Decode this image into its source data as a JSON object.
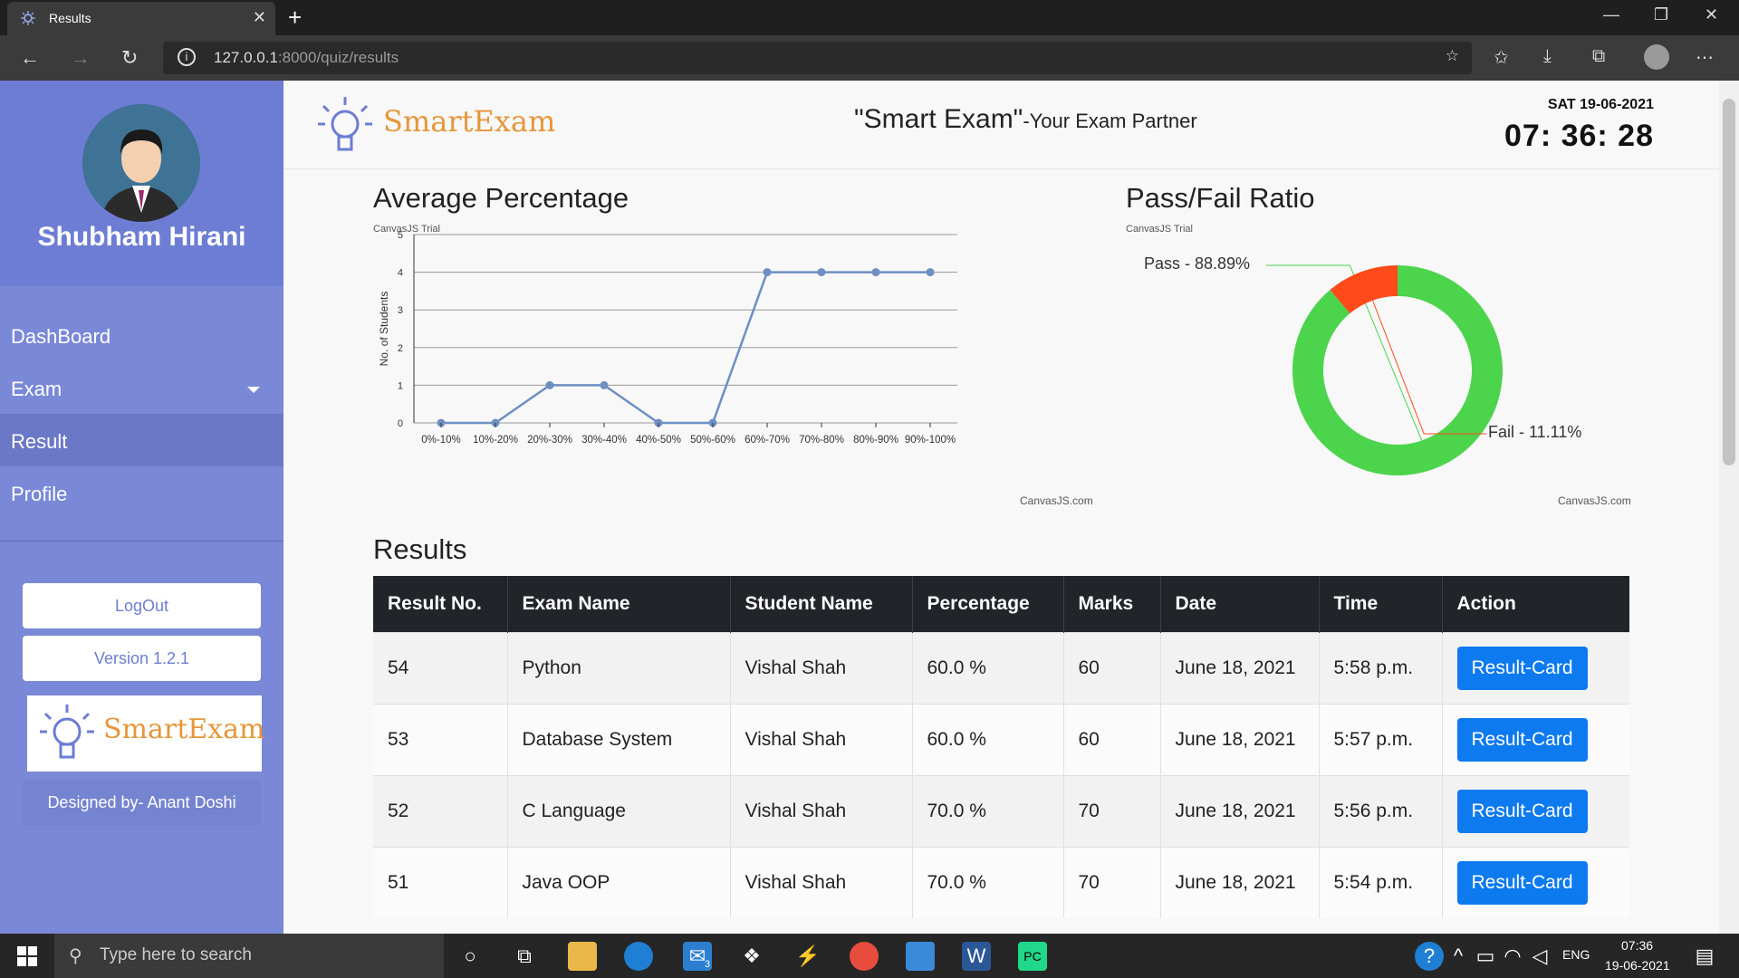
{
  "browser": {
    "tab_title": "Results",
    "url_host": "127.0.0.1",
    "url_rest": ":8000/quiz/results"
  },
  "sidebar": {
    "user_name": "Shubham Hirani",
    "menu": [
      "DashBoard",
      "Exam",
      "Result",
      "Profile"
    ],
    "logout": "LogOut",
    "version": "Version 1.2.1",
    "logo_text": "SmartExam",
    "designed_by": "Designed by- Anant Doshi"
  },
  "header": {
    "logo_text": "SmartExam",
    "title": "\"Smart Exam\"",
    "subtitle": "-Your Exam Partner",
    "date": "SAT 19-06-2021",
    "time": "07: 36: 28"
  },
  "chart_data": [
    {
      "type": "line",
      "title": "Average Percentage",
      "ylabel": "No. of Students",
      "categories": [
        "0%-10%",
        "10%-20%",
        "20%-30%",
        "30%-40%",
        "40%-50%",
        "50%-60%",
        "60%-70%",
        "70%-80%",
        "80%-90%",
        "90%-100%"
      ],
      "values": [
        0,
        0,
        1,
        1,
        0,
        0,
        4,
        4,
        4,
        4
      ],
      "ylim": [
        0,
        5
      ],
      "yticks": [
        0,
        1,
        2,
        3,
        4,
        5
      ],
      "color": "#6d8fc2",
      "trial_text": "CanvasJS Trial",
      "credit_text": "CanvasJS.com"
    },
    {
      "type": "pie",
      "title": "Pass/Fail Ratio",
      "slices": [
        {
          "label": "Pass - 88.89%",
          "value": 88.89,
          "color": "#4cd44c"
        },
        {
          "label": "Fail - 11.11%",
          "value": 11.11,
          "color": "#ff4a1a"
        }
      ],
      "trial_text": "CanvasJS Trial",
      "credit_text": "CanvasJS.com"
    }
  ],
  "results": {
    "heading": "Results",
    "columns": [
      "Result No.",
      "Exam Name",
      "Student Name",
      "Percentage",
      "Marks",
      "Date",
      "Time",
      "Action"
    ],
    "rows": [
      [
        "54",
        "Python",
        "Vishal Shah",
        "60.0 %",
        "60",
        "June 18, 2021",
        "5:58 p.m.",
        "Result-Card"
      ],
      [
        "53",
        "Database System",
        "Vishal Shah",
        "60.0 %",
        "60",
        "June 18, 2021",
        "5:57 p.m.",
        "Result-Card"
      ],
      [
        "52",
        "C Language",
        "Vishal Shah",
        "70.0 %",
        "70",
        "June 18, 2021",
        "5:56 p.m.",
        "Result-Card"
      ],
      [
        "51",
        "Java OOP",
        "Vishal Shah",
        "70.0 %",
        "70",
        "June 18, 2021",
        "5:54 p.m.",
        "Result-Card"
      ]
    ]
  },
  "taskbar": {
    "search_placeholder": "Type here to search",
    "mail_badge": "3",
    "lang": "ENG",
    "time": "07:36",
    "date": "19-06-2021"
  }
}
